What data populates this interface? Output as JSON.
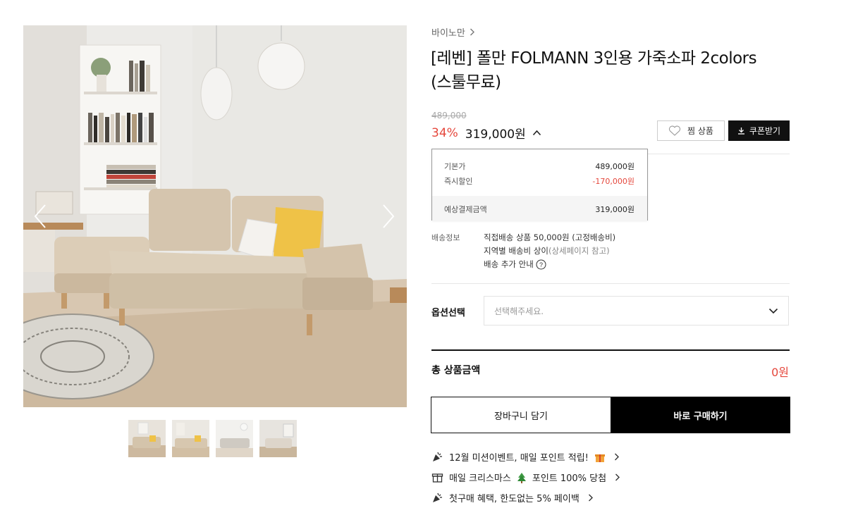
{
  "gallery": {
    "prev_icon": "chevron-left-icon",
    "next_icon": "chevron-right-icon",
    "thumbnail_count": 4
  },
  "product": {
    "brand": "바이노만",
    "title_line1": "[레벤] 폴만 FOLMANN 3인용 가죽소파 2colors",
    "title_line2": "(스툴무료)",
    "original_price": "489,000",
    "discount": "34%",
    "price": "319,000원"
  },
  "actions": {
    "wish_label": "찜 상품",
    "coupon_label": "쿠폰받기"
  },
  "price_detail": {
    "base_label": "기본가",
    "base_value": "489,000원",
    "instant_label": "즉시할인",
    "instant_value": "-170,000원",
    "expected_label": "예상결제금액",
    "expected_value": "319,000원"
  },
  "shipping": {
    "label": "배송정보",
    "line1": "직접배송 상품 50,000원 (고정배송비)",
    "line2_main": "지역별 배송비 상이",
    "line2_note": "(상세페이지 참고)",
    "line3": "배송 추가 안내"
  },
  "option": {
    "label": "옵션선택",
    "placeholder": "선택해주세요."
  },
  "total": {
    "label": "총 상품금액",
    "value": "0원"
  },
  "buttons": {
    "cart": "장바구니 담기",
    "buy": "바로 구매하기"
  },
  "promotions": [
    {
      "text": "12월 미션이벤트, 매일 포인트 적립!",
      "icon": "party-popper-icon"
    },
    {
      "text": "매일 크리스마스",
      "text2": "포인트 100% 당첨",
      "icon": "gift-icon"
    },
    {
      "text": "첫구매 혜택, 한도없는 5% 페이백",
      "icon": "party-popper-icon"
    }
  ],
  "colors": {
    "accent_red": "#e5473c",
    "primary_black": "#000000"
  }
}
